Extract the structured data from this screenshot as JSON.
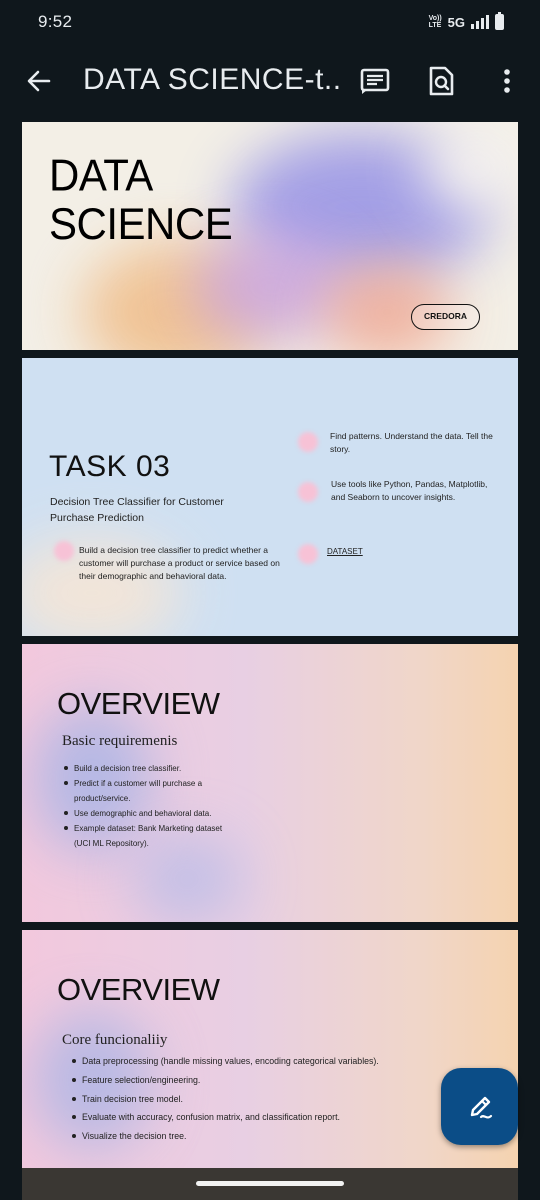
{
  "status_bar": {
    "time": "9:52",
    "volte_top": "Vo))",
    "volte_bottom": "LTE",
    "network": "5G"
  },
  "app_bar": {
    "title": "DATA SCIENCE-t...",
    "back_icon": "arrow-left-icon",
    "notes_icon": "speaker-notes-icon",
    "find_icon": "find-in-page-icon",
    "more_icon": "more-vert-icon"
  },
  "slides": [
    {
      "title_line1": "DATA",
      "title_line2": "SCIENCE",
      "badge": "CREDORA"
    },
    {
      "title": "TASK 03",
      "subtitle": "Decision Tree Classifier for Customer Purchase Prediction",
      "left_point": "Build a decision tree classifier to predict whether a customer will purchase a product or service based on their demographic and behavioral data.",
      "right_point_1": "Find patterns. Understand the data. Tell the story.",
      "right_point_2": "Use tools like Python, Pandas, Matplotlib, and Seaborn to uncover insights.",
      "link": "DATASET"
    },
    {
      "title": "OVERVIEW",
      "subtitle": "Basic requiremenis",
      "bullets": [
        "Build a decision tree classifier.",
        "Predict if a customer will purchase a",
        "product/service.",
        "Use demographic and behavioral data.",
        "Example dataset: Bank Marketing dataset",
        "(UCI ML Repository)."
      ]
    },
    {
      "title": "OVERVIEW",
      "subtitle": "Core funcionaliiy",
      "bullets": [
        "Data preprocessing (handle missing values, encoding categorical variables).",
        "Feature selection/engineering.",
        "Train decision tree model.",
        "Evaluate with accuracy, confusion matrix, and classification report.",
        "Visualize the decision tree."
      ]
    }
  ],
  "fab": {
    "icon": "edit-pen-icon",
    "color": "#0b4d87"
  },
  "colors": {
    "background": "#0f171c",
    "accent": "#0b4d87"
  }
}
